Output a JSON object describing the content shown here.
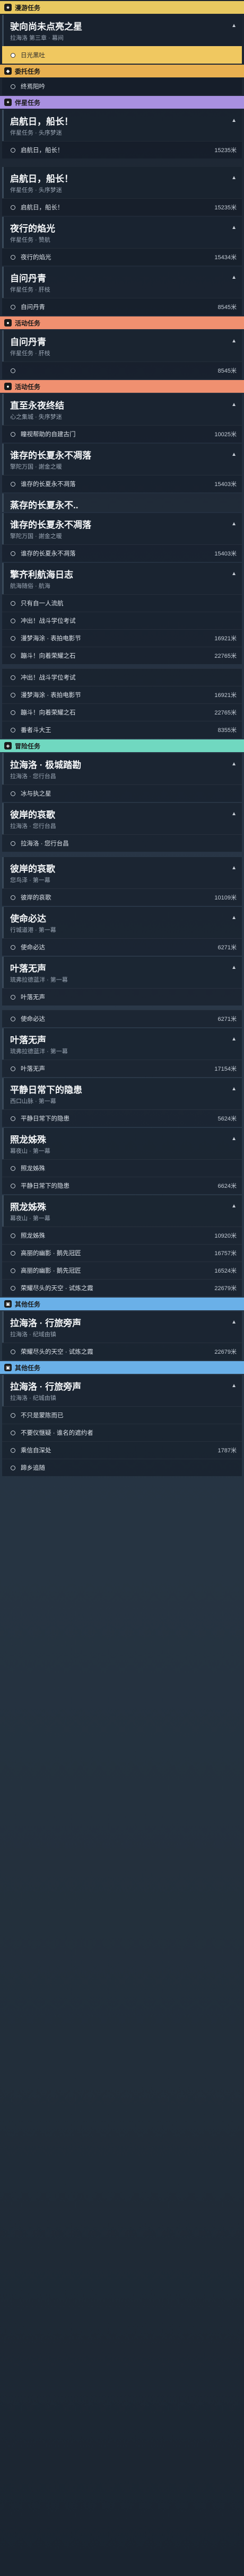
{
  "sections": {
    "main": {
      "label": "漫游任务",
      "color": "#e8c860"
    },
    "daily": {
      "label": "委托任务",
      "color": "#e8b050"
    },
    "companion": {
      "label": "伴星任务",
      "color": "#a890e0"
    },
    "event": {
      "label": "活动任务",
      "color": "#f09070"
    },
    "adventure": {
      "label": "冒险任务",
      "color": "#70d8c0"
    },
    "other": {
      "label": "其他任务",
      "color": "#6ab0e8"
    }
  },
  "q1": {
    "title": "驶向尚未点亮之星",
    "sub": "拉海洛 第三章 · 幕间",
    "step": "日光黑吐"
  },
  "q2": {
    "step": "终焉阳吟"
  },
  "q3": {
    "title": "启航日，船长！",
    "sub": "伴星任务 · 头序梦迷",
    "step": "启航日，船长！",
    "dist": "15235米"
  },
  "q4": {
    "title": "启航日，船长！",
    "sub": "伴星任务 · 头序梦迷",
    "step": "启航日，船长！",
    "dist": "15235米"
  },
  "q5": {
    "title": "夜行的焰光",
    "sub": "伴星任务 · 赞航",
    "step": "夜行的焰光",
    "dist": "15434米"
  },
  "q6": {
    "title": "自问丹青",
    "sub": "伴星任务 · 肝枝",
    "step": "自问丹青",
    "dist": "8545米"
  },
  "q7": {
    "title": "自问丹青",
    "sub": "伴星任务 · 肝枝",
    "dist": "8545米"
  },
  "q8": {
    "title": "直至永夜终结",
    "sub": "心之集城 · 失序梦迷",
    "step": "瞳视帮助的自建古门",
    "dist": "10025米",
    "tag": "心之集城"
  },
  "q9": {
    "title": "谁存的长夏永不凋落",
    "sub": "擎陀万国 · 謝金之暖",
    "step": "谁存的长夏永不凋落",
    "dist": "15403米"
  },
  "q10": {
    "title": "蒸存的长夏永不..",
    "sub": ""
  },
  "q11": {
    "title": "谁存的长夏永不凋落",
    "sub": "擎陀万国 · 謝金之暖",
    "step": "谁存的长夏永不凋落",
    "dist": "15403米"
  },
  "q12": {
    "title": "擎齐利航海日志",
    "sub": "航海随俗 · 航海",
    "tag": "航海随俗",
    "steps": [
      [
        "只有自一人流航",
        ""
      ],
      [
        "冲出！战斗学位考试",
        ""
      ],
      [
        "漫梦海涂 · 表拍电影节",
        "16921米"
      ],
      [
        "蹦斗！向着荣耀之石",
        "22765米"
      ]
    ]
  },
  "q13": {
    "tag": "心之集城",
    "steps": [
      [
        "冲出！战斗学位考试",
        ""
      ],
      [
        "漫梦海涂 · 表拍电影节",
        "16921米"
      ],
      [
        "蹦斗！向着荣耀之石",
        "22765米"
      ],
      [
        "番者斗大王",
        "8355米"
      ]
    ]
  },
  "q14": {
    "title": "拉海洛 · 极城踏勘",
    "sub": "拉海洛 · 您行台昌",
    "step": "冰与执之星"
  },
  "q15": {
    "title": "彼岸的哀歌",
    "sub": "拉海洛 · 您行台昌",
    "step": "拉海洛 · 您行台昌"
  },
  "q16": {
    "title": "彼岸的哀歌",
    "sub": "您鸟泽 · 第一幕",
    "step": "彼岸的哀歌",
    "dist": "10109米"
  },
  "q17": {
    "title": "使命必达",
    "sub": "行城道港 · 第一幕",
    "step": "使命必达",
    "dist": "6271米"
  },
  "q18": {
    "title": "叶落无声",
    "sub": "琉弗拉德蓝洋 · 第一幕",
    "step": "叶落无声"
  },
  "q19": {
    "step": "使命必达",
    "dist": "6271米"
  },
  "q20": {
    "title": "叶落无声",
    "sub": "琉弗拉德蓝洋 · 第一幕",
    "step": "叶落无声",
    "dist": "17154米"
  },
  "q21": {
    "title": "平静日常下的隐患",
    "sub": "西口山脉 · 第一幕",
    "step": "平静日常下的隐患",
    "dist": "5624米"
  },
  "q22": {
    "title": "照龙姊殊",
    "sub": "幕夜山 · 第一幕",
    "step": "照龙姊殊"
  },
  "q23": {
    "step": "平静日常下的隐患",
    "dist": "6624米"
  },
  "q24": {
    "title": "照龙姊殊",
    "sub": "幕夜山 · 第一幕",
    "steps": [
      [
        "照龙姊殊",
        "10920米"
      ],
      [
        "高丽的幽影 · 鹅先冠匠",
        "16757米"
      ],
      [
        "高丽的幽影 · 鹅先冠匠",
        "16524米"
      ],
      [
        "荣耀尽头的天空 · 试炼之霞",
        "22679米"
      ]
    ]
  },
  "q25": {
    "title": "拉海洛 · 行旅旁声",
    "sub": "拉海洛 · 纪域由镇",
    "steps": [
      [
        "荣耀尽头的天空 · 试炼之霞",
        "22679米"
      ]
    ]
  },
  "q26": {
    "title": "拉海洛 · 行旅旁声",
    "sub": "拉海洛 · 纪城由镇",
    "steps": [
      [
        "不只是蒙陈而已",
        ""
      ],
      [
        "不要仪惬疑 · 谁名的遮约者",
        ""
      ],
      [
        "乘信自深处",
        "1787米"
      ],
      [
        "蹄乡追随",
        ""
      ]
    ]
  }
}
